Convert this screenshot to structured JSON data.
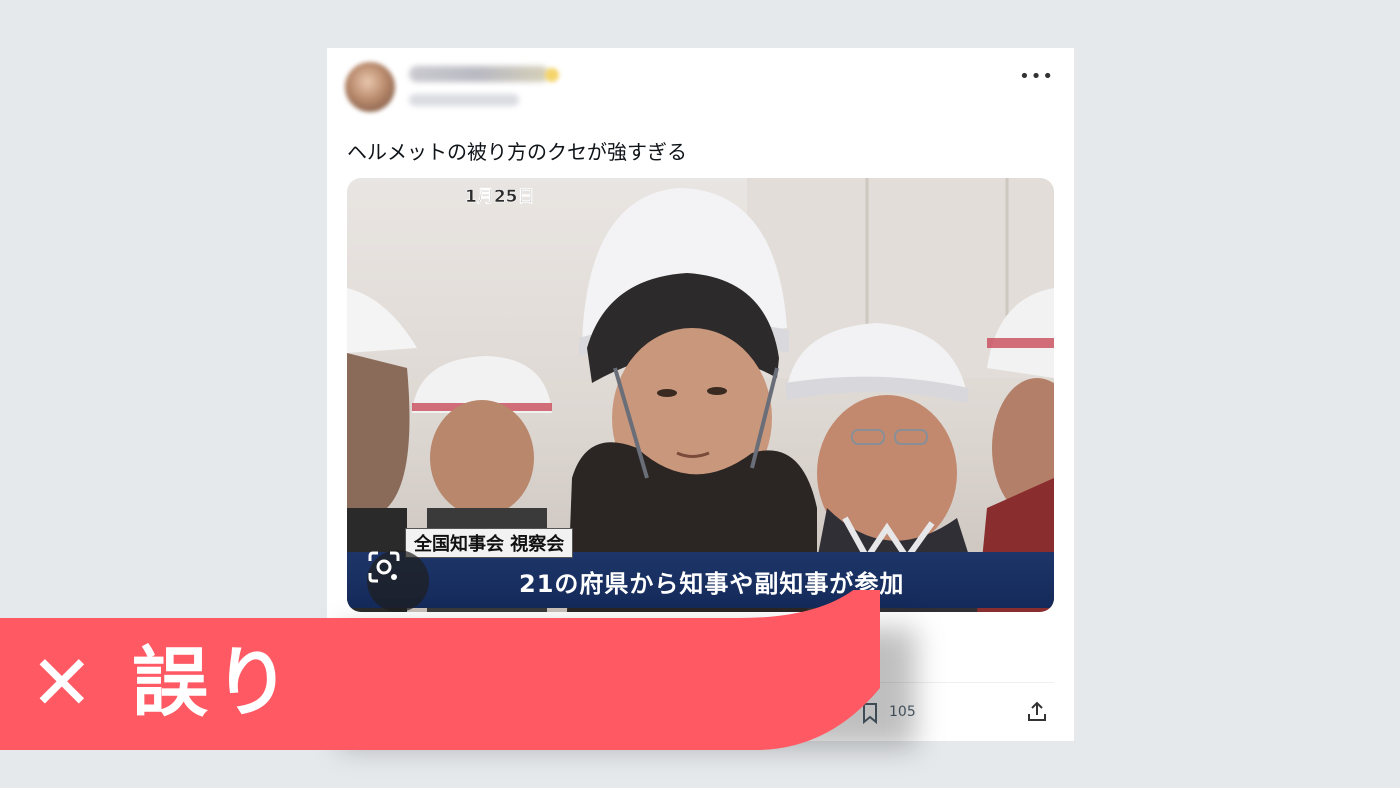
{
  "tweet": {
    "text": "ヘルメットの被り方のクセが強すぎる",
    "more_icon": "more-horizontal-icon",
    "image": {
      "date_label": "1月25日",
      "caption_top": "全国知事会 視察会",
      "caption_main": "21の府県から知事や副知事が参加"
    },
    "actions": {
      "bookmark_count": "105"
    }
  },
  "verdict": {
    "label": "✕ 誤り",
    "color": "#ff5a64"
  }
}
